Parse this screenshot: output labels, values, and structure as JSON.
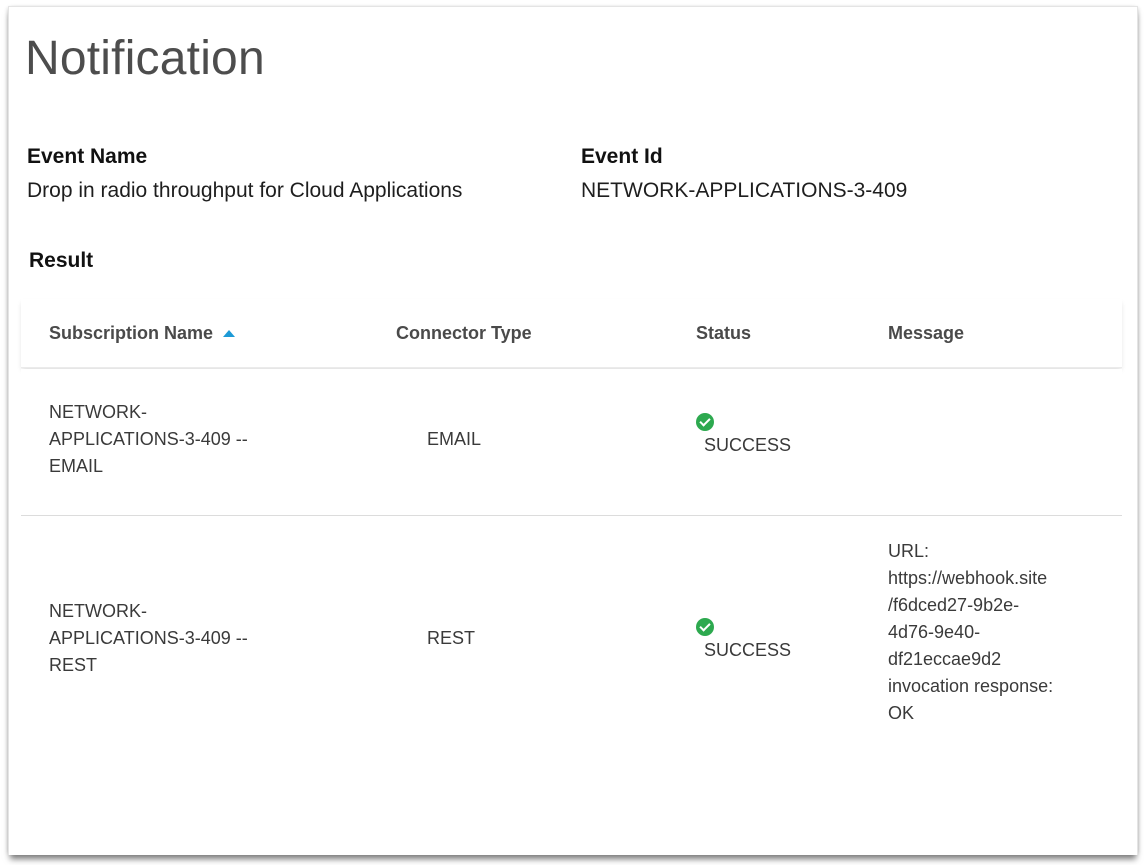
{
  "page": {
    "title": "Notification"
  },
  "event": {
    "name_label": "Event Name",
    "name_value": "Drop in radio throughput for Cloud Applications",
    "id_label": "Event Id",
    "id_value": "NETWORK-APPLICATIONS-3-409"
  },
  "result": {
    "label": "Result",
    "columns": [
      "Subscription Name",
      "Connector Type",
      "Status",
      "Message"
    ],
    "sort": {
      "column": "Subscription Name",
      "direction": "ascending",
      "icon": "sort-ascending-icon"
    },
    "rows": [
      {
        "subscription_lines": [
          "NETWORK-",
          "APPLICATIONS-3-409 --",
          "EMAIL"
        ],
        "connector_type": "EMAIL",
        "status": "SUCCESS",
        "status_icon": "success-check-icon",
        "message_lines": []
      },
      {
        "subscription_lines": [
          "NETWORK-",
          "APPLICATIONS-3-409 --",
          "REST"
        ],
        "connector_type": "REST",
        "status": "SUCCESS",
        "status_icon": "success-check-icon",
        "message_lines": [
          "URL:",
          "https://webhook.site",
          "/f6dced27-9b2e-",
          "4d76-9e40-",
          "df21eccae9d2",
          "invocation response:",
          "OK"
        ]
      }
    ]
  },
  "colors": {
    "success": "#2da94f",
    "sort_indicator": "#1d9ad6",
    "title": "#4d4d4d"
  }
}
